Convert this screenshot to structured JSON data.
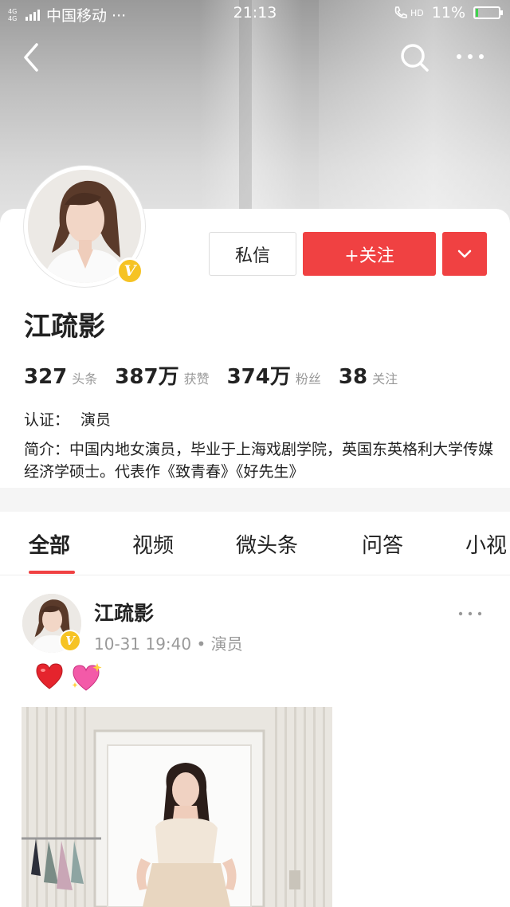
{
  "status_bar": {
    "network": "4G 4G",
    "carrier": "中国移动 ···",
    "time": "21:13",
    "battery_percent": "11%",
    "battery_level": 0.11,
    "hd": "HD"
  },
  "nav": {
    "back_icon": "chevron-left-icon",
    "search_icon": "search-icon",
    "more_icon": "more-dots-icon"
  },
  "profile": {
    "name": "江疏影",
    "message_label": "私信",
    "follow_label": "+关注",
    "dropdown_icon": "chevron-down-icon",
    "verified_badge": "V",
    "stats": [
      {
        "value": "327",
        "label": "头条"
      },
      {
        "value": "387万",
        "label": "获赞"
      },
      {
        "value": "374万",
        "label": "粉丝"
      },
      {
        "value": "38",
        "label": "关注"
      }
    ],
    "certification_key": "认证：",
    "certification_value": "演员",
    "intro_key": "简介：",
    "intro_value": "中国内地女演员，毕业于上海戏剧学院，英国东英格利大学传媒经济学硕士。代表作《致青春》《好先生》"
  },
  "tabs": [
    {
      "label": "全部",
      "active": true
    },
    {
      "label": "视频",
      "active": false
    },
    {
      "label": "微头条",
      "active": false
    },
    {
      "label": "问答",
      "active": false
    },
    {
      "label": "小视",
      "active": false
    }
  ],
  "post": {
    "author": "江疏影",
    "time": "10-31 19:40",
    "tag": "演员",
    "meta": "10-31 19:40 • 演员",
    "emojis": [
      "heart-emoji",
      "sparkling-heart-emoji"
    ],
    "more_icon": "more-dots-icon"
  },
  "colors": {
    "accent": "#f04142",
    "badge": "#f6c324",
    "muted_text": "#999999"
  }
}
